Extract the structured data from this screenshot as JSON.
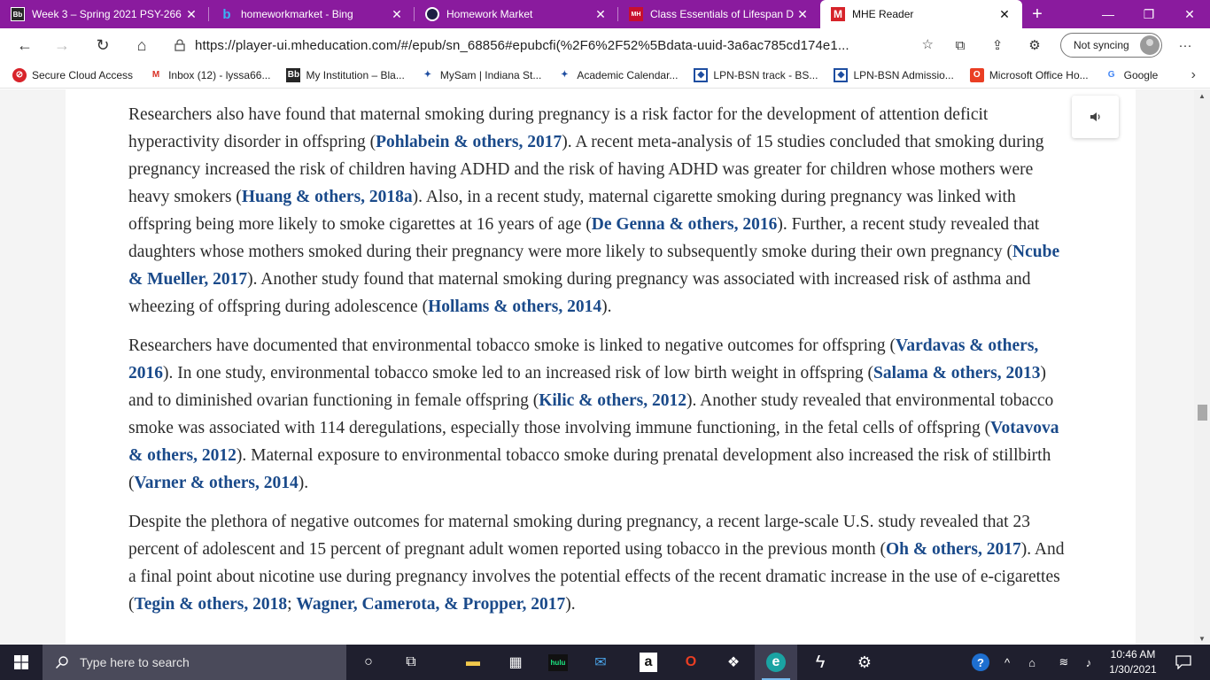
{
  "browser": {
    "tabs": [
      {
        "title": "Week 3 – Spring 2021 PSY-266",
        "favicon": "blackboard-icon",
        "active": false
      },
      {
        "title": "homeworkmarket - Bing",
        "favicon": "bing-icon",
        "active": false
      },
      {
        "title": "Homework Market",
        "favicon": "homework-market-icon",
        "active": false
      },
      {
        "title": "Class Essentials of Lifespan De",
        "favicon": "class-essentials-icon",
        "active": false
      },
      {
        "title": "MHE Reader",
        "favicon": "mhe-icon",
        "active": true
      }
    ],
    "favicon_text": {
      "bb": "Bb",
      "bing": "b",
      "mhe": "M",
      "ce": "MH"
    },
    "tab_close_symbol": "✕",
    "new_tab_symbol": "+",
    "window_controls": {
      "minimize": "—",
      "restore": "❐",
      "close": "✕"
    },
    "nav": {
      "back": "←",
      "forward": "→",
      "refresh": "↻",
      "home": "⌂"
    },
    "url": "https://player-ui.mheducation.com/#/epub/sn_68856#epubcfi(%2F6%2F52%5Bdata-uuid-3a6ac785cd174e1...",
    "profile_label": "Not syncing",
    "more_menu": "···",
    "tool_icons": {
      "add_favorite": "☆",
      "collections": "⧉",
      "share": "⇪",
      "extensions": "⚙"
    },
    "bookmarks": [
      {
        "label": "Secure Cloud Access",
        "icon": "secure-cloud-icon",
        "glyph": "⊘"
      },
      {
        "label": "Inbox (12) - lyssa66...",
        "icon": "gmail-icon",
        "glyph": "M"
      },
      {
        "label": "My Institution – Bla...",
        "icon": "blackboard-icon",
        "glyph": "Bb"
      },
      {
        "label": "MySam | Indiana St...",
        "icon": "star-bookmark-icon",
        "glyph": "✦"
      },
      {
        "label": "Academic Calendar...",
        "icon": "star-bookmark-icon",
        "glyph": "✦"
      },
      {
        "label": "LPN-BSN track - BS...",
        "icon": "page-bookmark-icon",
        "glyph": "◆"
      },
      {
        "label": "LPN-BSN Admissio...",
        "icon": "page-bookmark-icon",
        "glyph": "◆"
      },
      {
        "label": "Microsoft Office Ho...",
        "icon": "office-icon",
        "glyph": "O"
      },
      {
        "label": "Google",
        "icon": "google-icon",
        "glyph": "G"
      }
    ],
    "bookmarks_more": "›"
  },
  "reader": {
    "paragraphs": [
      [
        {
          "t": "Researchers also have found that maternal smoking during pregnancy is a risk factor for the development of attention deficit hyperactivity disorder in offspring ("
        },
        {
          "t": "Pohlabein & others, 2017",
          "c": true
        },
        {
          "t": "). A recent meta-analysis of 15 studies concluded that smoking during pregnancy increased the risk of children having ADHD and the risk of having ADHD was greater for children whose mothers were heavy smokers ("
        },
        {
          "t": "Huang & others, 2018a",
          "c": true
        },
        {
          "t": "). Also, in a recent study, maternal cigarette smoking during pregnancy was linked with offspring being more likely to smoke cigarettes at 16 years of age ("
        },
        {
          "t": "De Genna & others, 2016",
          "c": true
        },
        {
          "t": "). Further, a recent study revealed that daughters whose mothers smoked during their pregnancy were more likely to subsequently smoke during their own pregnancy ("
        },
        {
          "t": "Ncube & Mueller, 2017",
          "c": true
        },
        {
          "t": "). Another study found that maternal smoking during pregnancy was associated with increased risk of asthma and wheezing of offspring during adolescence ("
        },
        {
          "t": "Hollams & others, 2014",
          "c": true
        },
        {
          "t": ")."
        }
      ],
      [
        {
          "t": "Researchers have documented that environmental tobacco smoke is linked to negative outcomes for offspring ("
        },
        {
          "t": "Vardavas & others, 2016",
          "c": true
        },
        {
          "t": "). In one study, environmental tobacco smoke led to an increased risk of low birth weight in offspring ("
        },
        {
          "t": "Salama & others, 2013",
          "c": true
        },
        {
          "t": ") and to diminished ovarian functioning in female offspring ("
        },
        {
          "t": "Kilic & others, 2012",
          "c": true
        },
        {
          "t": "). Another study revealed that environmental tobacco smoke was associated with 114 deregulations, especially those involving immune functioning, in the fetal cells of offspring ("
        },
        {
          "t": "Votavova & others, 2012",
          "c": true
        },
        {
          "t": "). Maternal exposure to environmental tobacco smoke during prenatal development also increased the risk of stillbirth ("
        },
        {
          "t": "Varner & others, 2014",
          "c": true
        },
        {
          "t": ")."
        }
      ],
      [
        {
          "t": "Despite the plethora of negative outcomes for maternal smoking during pregnancy, a recent large-scale U.S. study revealed that 23 percent of adolescent and 15 percent of pregnant adult women reported using tobacco in the previous month ("
        },
        {
          "t": "Oh & others, 2017",
          "c": true
        },
        {
          "t": "). And a final point about nicotine use during pregnancy involves the potential effects of the recent dramatic increase in the use of e-cigarettes ("
        },
        {
          "t": "Tegin & others, 2018",
          "c": true
        },
        {
          "t": "; "
        },
        {
          "t": "Wagner, Camerota, & Propper, 2017",
          "c": true
        },
        {
          "t": ")."
        }
      ]
    ],
    "audio_icon": "speaker-icon",
    "scroll_up": "▲",
    "scroll_down": "▼"
  },
  "taskbar": {
    "search_placeholder": "Type here to search",
    "apps": [
      {
        "name": "cortana-icon",
        "glyph": "○"
      },
      {
        "name": "task-view-icon",
        "glyph": "⧉"
      },
      {
        "name": "file-explorer-icon",
        "glyph": "▬"
      },
      {
        "name": "store-icon",
        "glyph": "▦"
      },
      {
        "name": "hulu-icon",
        "glyph": "hulu"
      },
      {
        "name": "mail-icon",
        "glyph": "✉"
      },
      {
        "name": "amazon-icon",
        "glyph": "a"
      },
      {
        "name": "office-icon",
        "glyph": "O"
      },
      {
        "name": "dropbox-icon",
        "glyph": "❖"
      },
      {
        "name": "edge-icon",
        "glyph": "e"
      },
      {
        "name": "lightning-icon",
        "glyph": "ϟ"
      },
      {
        "name": "settings-icon",
        "glyph": "⚙"
      }
    ],
    "tray": {
      "help": "?",
      "chevron": "^",
      "network": "⌂",
      "wifi": "≋",
      "volume": "♪"
    },
    "time": "10:46 AM",
    "date": "1/30/2021"
  },
  "colors": {
    "tab_bar": "#8a1b9e",
    "citation": "#1a4a8a",
    "body_text": "#2b2b2b",
    "taskbar": "#1f1f2e"
  }
}
